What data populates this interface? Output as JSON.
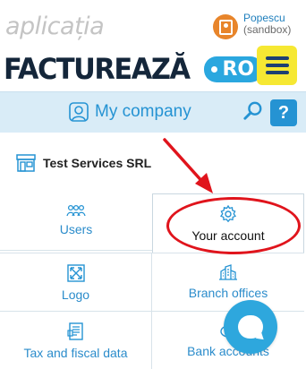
{
  "header": {
    "app_brand": "aplicația",
    "logo_text": "FACTUREAZĂ",
    "logo_suffix": "RO",
    "user_name": "Popescu",
    "user_account": "(sandbox)"
  },
  "company_bar": {
    "label": "My company",
    "help_label": "?"
  },
  "company": {
    "name": "Test Services SRL"
  },
  "grid": {
    "users": "Users",
    "your_account": "Your account",
    "logo": "Logo",
    "branch_offices": "Branch offices",
    "tax_fiscal": "Tax and fiscal data",
    "bank_accounts": "Bank accounts"
  },
  "colors": {
    "accent": "#2593d3",
    "menu_yellow": "#f6e833",
    "annotation_red": "#e0141c"
  }
}
